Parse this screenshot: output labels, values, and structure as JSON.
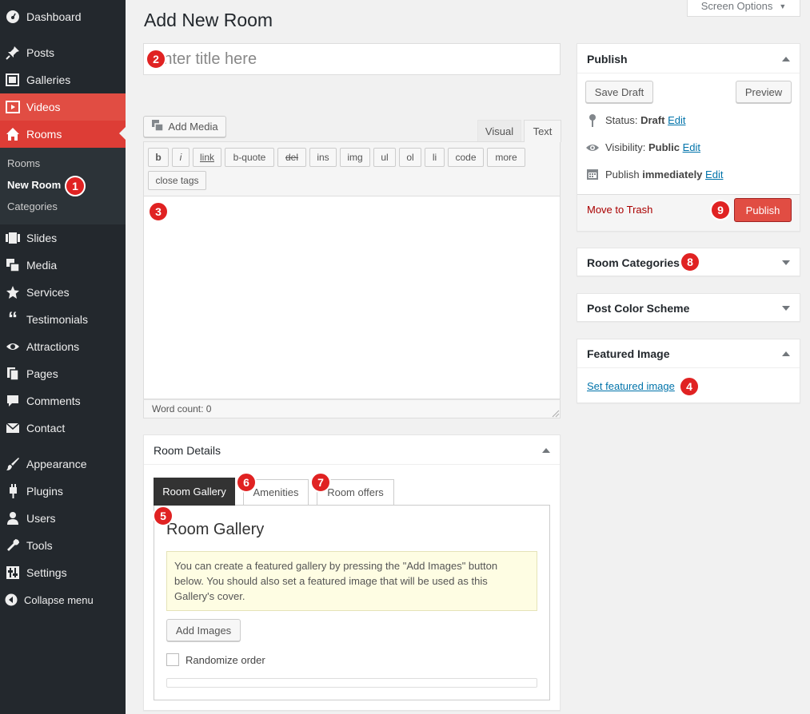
{
  "sidebar": {
    "items": [
      {
        "label": "Dashboard",
        "icon": "dashboard-icon"
      },
      {
        "label": "Posts",
        "icon": "pin-icon"
      },
      {
        "label": "Galleries",
        "icon": "gallery-icon"
      },
      {
        "label": "Videos",
        "icon": "video-icon"
      },
      {
        "label": "Rooms",
        "icon": "home-icon"
      },
      {
        "label": "Slides",
        "icon": "slides-icon"
      },
      {
        "label": "Media",
        "icon": "media-icon"
      },
      {
        "label": "Services",
        "icon": "star-icon"
      },
      {
        "label": "Testimonials",
        "icon": "quote-icon"
      },
      {
        "label": "Attractions",
        "icon": "eye-icon"
      },
      {
        "label": "Pages",
        "icon": "pages-icon"
      },
      {
        "label": "Comments",
        "icon": "comment-icon"
      },
      {
        "label": "Contact",
        "icon": "mail-icon"
      },
      {
        "label": "Appearance",
        "icon": "brush-icon"
      },
      {
        "label": "Plugins",
        "icon": "plugin-icon"
      },
      {
        "label": "Users",
        "icon": "user-icon"
      },
      {
        "label": "Tools",
        "icon": "wrench-icon"
      },
      {
        "label": "Settings",
        "icon": "settings-icon"
      },
      {
        "label": "Collapse menu",
        "icon": "collapse-icon"
      }
    ],
    "submenu": [
      "Rooms",
      "New Room",
      "Categories"
    ]
  },
  "header": {
    "title": "Add New Room",
    "screen_options": "Screen Options"
  },
  "editor": {
    "title_placeholder": "Enter title here",
    "add_media": "Add Media",
    "tab_visual": "Visual",
    "tab_text": "Text",
    "quicktags": [
      "b",
      "i",
      "link",
      "b-quote",
      "del",
      "ins",
      "img",
      "ul",
      "ol",
      "li",
      "code",
      "more",
      "close tags"
    ],
    "word_count": "Word count: 0"
  },
  "publish": {
    "title": "Publish",
    "save_draft": "Save Draft",
    "preview": "Preview",
    "status_label": "Status:",
    "status_value": "Draft",
    "visibility_label": "Visibility:",
    "visibility_value": "Public",
    "publish_label": "Publish",
    "publish_value": "immediately",
    "edit": "Edit",
    "trash": "Move to Trash",
    "publish_button": "Publish"
  },
  "boxes": {
    "room_categories": "Room Categories",
    "post_color_scheme": "Post Color Scheme",
    "featured_image": "Featured Image",
    "set_featured_image": "Set featured image"
  },
  "room_details": {
    "title": "Room Details",
    "tabs": [
      "Room Gallery",
      "Amenities",
      "Room offers"
    ],
    "heading": "Room Gallery",
    "notice": "You can create a featured gallery by pressing the \"Add Images\" button below. You should also set a featured image that will be used as this Gallery's cover.",
    "add_images": "Add Images",
    "randomize": "Randomize order"
  },
  "badges": [
    "1",
    "2",
    "3",
    "4",
    "5",
    "6",
    "7",
    "8",
    "9"
  ],
  "colors": {
    "sidebar_bg": "#23282d",
    "accent_red": "#e14d43",
    "badge_red": "#e02222",
    "link_blue": "#0073aa"
  }
}
